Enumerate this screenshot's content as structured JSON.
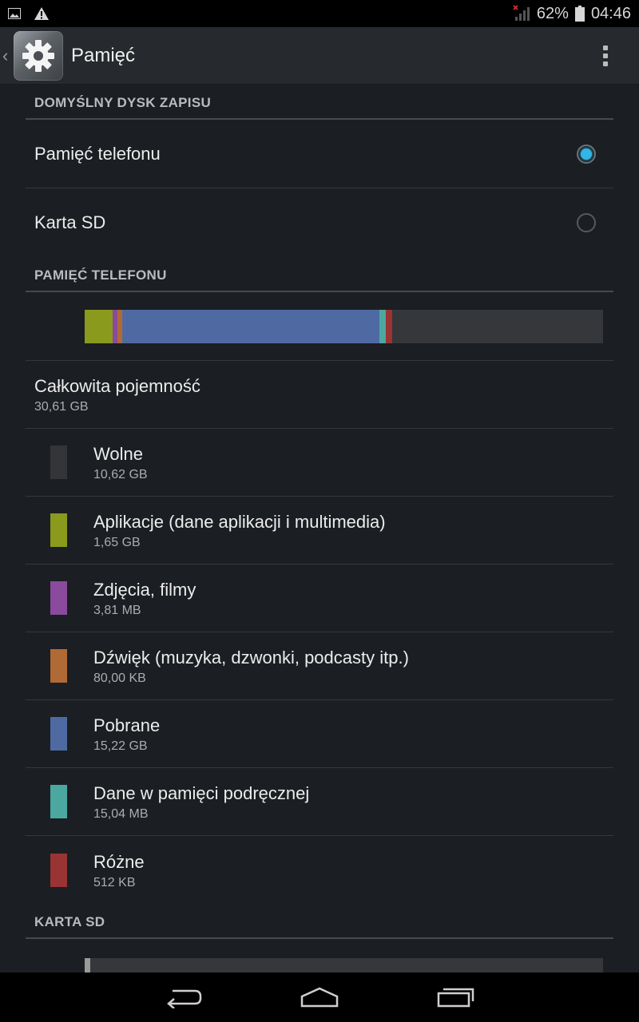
{
  "status_bar": {
    "battery_percent": "62%",
    "time": "04:46",
    "icons": [
      "image-notification-icon",
      "warning-icon",
      "no-signal-icon",
      "battery-icon"
    ]
  },
  "action_bar": {
    "title": "Pamięć",
    "icon": "settings-gear-icon",
    "overflow_icon": "overflow-menu-icon"
  },
  "default_disk": {
    "header": "DOMYŚLNY DYSK ZAPISU",
    "options": [
      {
        "label": "Pamięć telefonu",
        "checked": true
      },
      {
        "label": "Karta SD",
        "checked": false
      }
    ]
  },
  "phone_memory": {
    "header": "PAMIĘĆ TELEFONU",
    "usage_bar": [
      {
        "category": "Aplikacje",
        "fraction": 0.054,
        "color": "#8a9a1d"
      },
      {
        "category": "Zdjęcia",
        "fraction": 0.009,
        "color": "#8a4a9e"
      },
      {
        "category": "Dźwięk",
        "fraction": 0.009,
        "color": "#b06a35"
      },
      {
        "category": "Pobrane",
        "fraction": 0.497,
        "color": "#4f6aa3"
      },
      {
        "category": "Dane w pamięci podręcznej",
        "fraction": 0.012,
        "color": "#4aa8a0"
      },
      {
        "category": "Różne",
        "fraction": 0.012,
        "color": "#9a3333"
      },
      {
        "category": "Wolne",
        "fraction": 0.407,
        "color": "#35373a"
      }
    ],
    "total": {
      "label": "Całkowita pojemność",
      "value": "30,61 GB"
    },
    "categories": [
      {
        "label": "Wolne",
        "value": "10,62 GB",
        "color": "#343538"
      },
      {
        "label": "Aplikacje (dane aplikacji i multimedia)",
        "value": "1,65 GB",
        "color": "#8a9a1d"
      },
      {
        "label": "Zdjęcia, filmy",
        "value": "3,81 MB",
        "color": "#8a4a9e"
      },
      {
        "label": "Dźwięk (muzyka, dzwonki, podcasty itp.)",
        "value": "80,00 KB",
        "color": "#b06a35"
      },
      {
        "label": "Pobrane",
        "value": "15,22 GB",
        "color": "#4f6aa3"
      },
      {
        "label": "Dane w pamięci podręcznej",
        "value": "15,04 MB",
        "color": "#4aa8a0"
      },
      {
        "label": "Różne",
        "value": "512 KB",
        "color": "#9a3333"
      }
    ]
  },
  "sd_card": {
    "header": "KARTA SD",
    "used_fraction": 0.011
  },
  "nav_bar": {
    "buttons": [
      "back-icon",
      "home-icon",
      "recents-icon"
    ]
  }
}
